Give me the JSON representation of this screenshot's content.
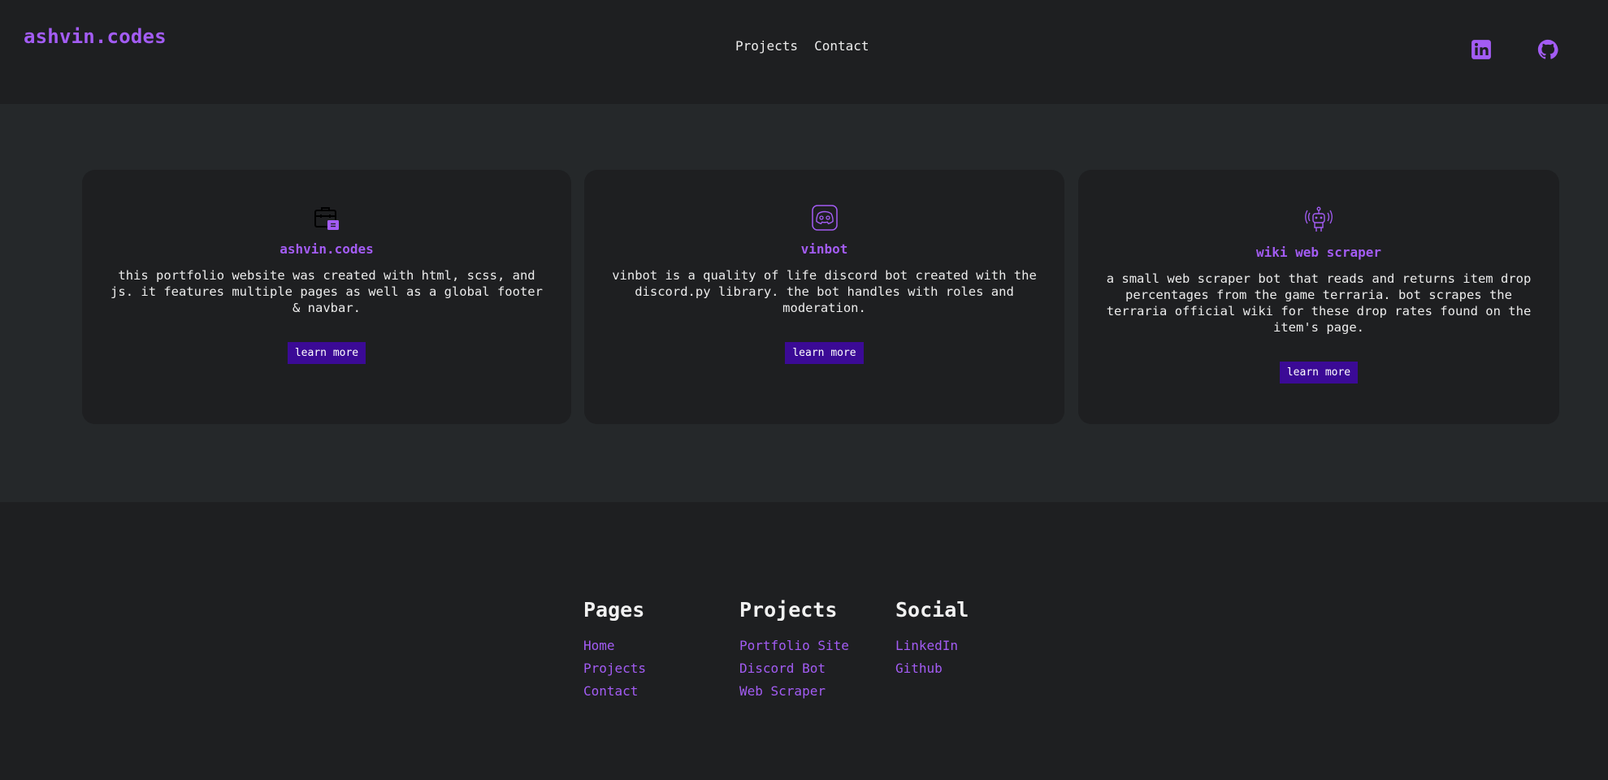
{
  "header": {
    "logo": "ashvin.codes",
    "nav": [
      {
        "label": "Projects"
      },
      {
        "label": "Contact"
      }
    ],
    "social_icons": [
      "linkedin-icon",
      "github-icon"
    ]
  },
  "cards": [
    {
      "icon": "portfolio-briefcase-icon",
      "title": "ashvin.codes",
      "description": "this portfolio website was created with html, scss, and js. it features multiple pages as well as a global footer & navbar.",
      "button": "learn more"
    },
    {
      "icon": "discord-bot-icon",
      "title": "vinbot",
      "description": "vinbot is a quality of life discord bot created with the discord.py library. the bot handles with roles and moderation.",
      "button": "learn more"
    },
    {
      "icon": "web-scraper-bot-icon",
      "title": "wiki web scraper",
      "description": "a small web scraper bot that reads and returns item drop percentages from the game terraria. bot scrapes the terraria official wiki for these drop rates found on the item's page.",
      "button": "learn more"
    }
  ],
  "footer": {
    "columns": [
      {
        "title": "Pages",
        "links": [
          "Home",
          "Projects",
          "Contact"
        ]
      },
      {
        "title": "Projects",
        "links": [
          "Portfolio Site",
          "Discord Bot",
          "Web Scraper"
        ]
      },
      {
        "title": "Social",
        "links": [
          "LinkedIn",
          "Github"
        ]
      }
    ]
  },
  "colors": {
    "accent": "#a35cf4",
    "button_bg": "#3b0a96",
    "page_bg": "#1e1f21",
    "section_bg": "#25282a"
  }
}
